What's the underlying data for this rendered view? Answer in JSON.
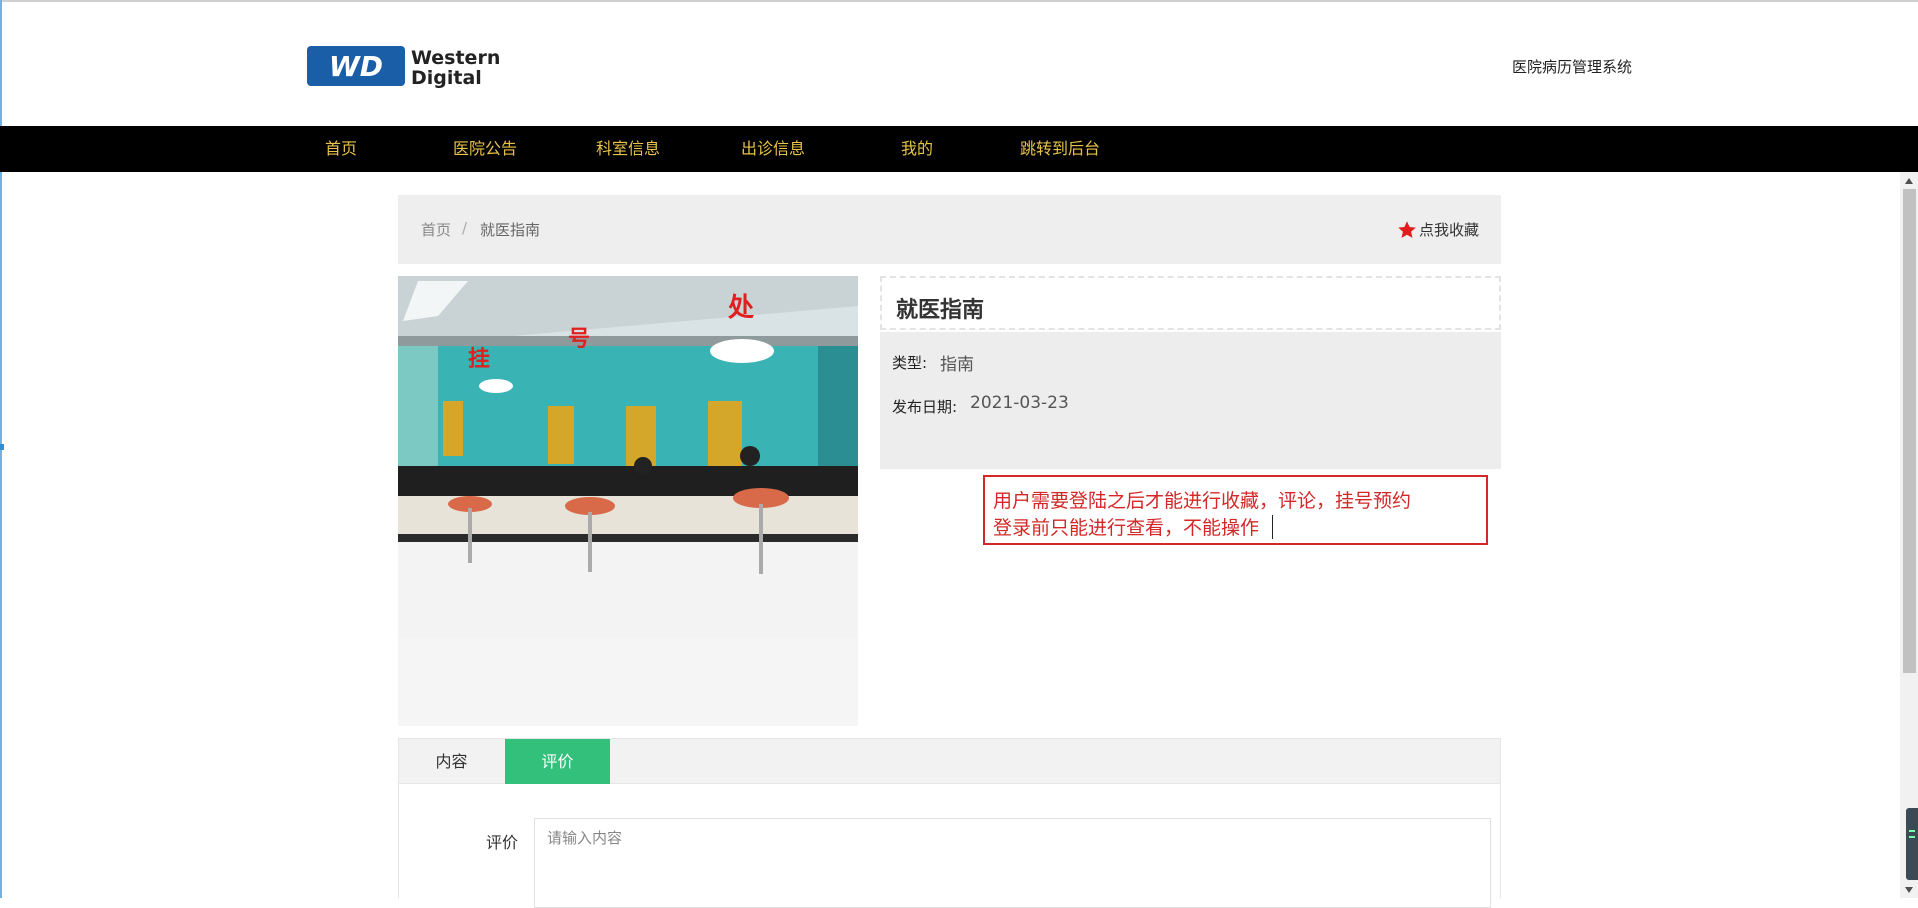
{
  "header": {
    "logo_mark": "WD",
    "logo_text_line1": "Western",
    "logo_text_line2": "Digital",
    "system_title": "医院病历管理系统"
  },
  "nav": {
    "items": [
      "首页",
      "医院公告",
      "科室信息",
      "出诊信息",
      "我的",
      "跳转到后台"
    ],
    "text_color": "#e8c34a",
    "background": "#000000"
  },
  "breadcrumb": {
    "home": "首页",
    "separator": "/",
    "current": "就医指南",
    "favorite_label": "点我收藏",
    "favorite_icon": "star-icon",
    "favorite_icon_color": "#e01c1c"
  },
  "detail": {
    "title": "就医指南",
    "type_label": "类型:",
    "type_value": "指南",
    "date_label": "发布日期:",
    "date_value": "2021-03-23"
  },
  "annotation": {
    "line1": "用户需要登陆之后才能进行收藏，评论，挂号预约",
    "line2": "登录前只能进行查看，不能操作",
    "color": "#d42828"
  },
  "tabs": {
    "items": [
      "内容",
      "评价"
    ],
    "active": "评价",
    "active_color": "#33c07a"
  },
  "review": {
    "label": "评价",
    "placeholder": "请输入内容",
    "value": ""
  }
}
